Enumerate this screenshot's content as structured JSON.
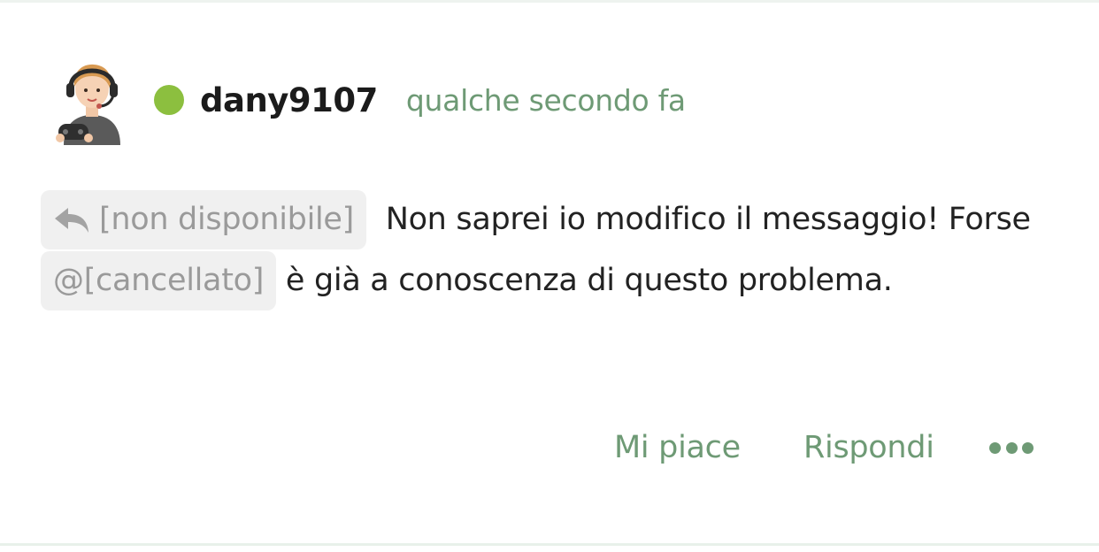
{
  "author": {
    "username": "dany9107",
    "status_color": "#8cbf3f",
    "avatar_icon": "gamer-headset-avatar-icon"
  },
  "timestamp": "qualche secondo fa",
  "message": {
    "reply_chip_label": "[non disponibile]",
    "reply_icon": "reply-arrow-icon",
    "text_part1": "Non saprei io modifico il messaggio! Forse",
    "mention_label": "@[cancellato]",
    "text_part2": "è già a conoscenza di questo problema."
  },
  "actions": {
    "like_label": "Mi piace",
    "reply_label": "Rispondi",
    "more_icon": "more-dots-icon"
  },
  "colors": {
    "accent": "#6e9a75",
    "chip_bg": "#f0f0f0",
    "chip_text": "#9a9a9a",
    "text": "#222222"
  }
}
